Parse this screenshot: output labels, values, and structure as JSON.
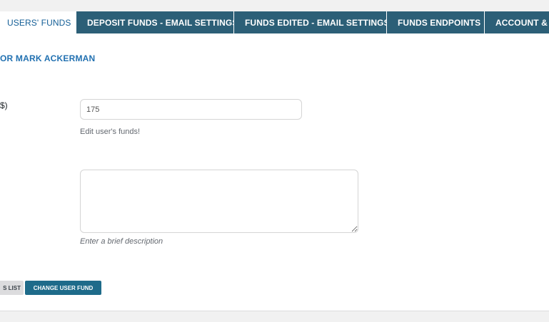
{
  "tabs": [
    {
      "label": "Users' Funds"
    },
    {
      "label": "Deposit Funds - Email Settings"
    },
    {
      "label": "Funds Edited - Email Settings"
    },
    {
      "label": "Funds Endpoints"
    },
    {
      "label": "Account & P"
    }
  ],
  "panel": {
    "title": "or Mark Ackerman",
    "amount_label": "$)",
    "amount_value": "175",
    "amount_hint": "Edit user's funds!",
    "description_value": "",
    "description_hint": "Enter a brief description",
    "back_button": "s List",
    "submit_button": "Change user fund"
  },
  "colors": {
    "tab_dark": "#2c5f77",
    "primary_button": "#1e6b8a",
    "title_link": "#2271b1"
  }
}
